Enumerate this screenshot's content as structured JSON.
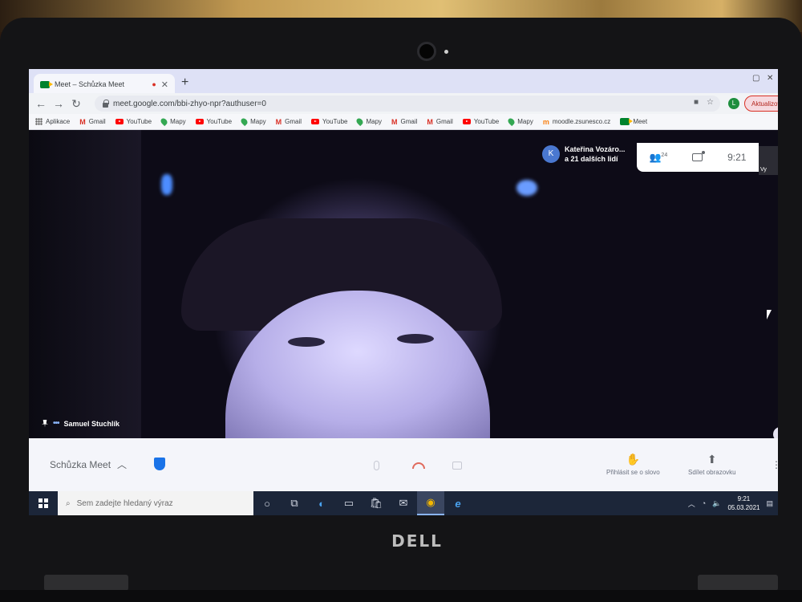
{
  "browser": {
    "tab_title": "Meet – Schůzka Meet",
    "tab_close": "✕",
    "new_tab": "+",
    "url": "meet.google.com/bbi-zhyo-npr?authuser=0",
    "profile_initial": "L",
    "update_label": "Aktualizovat",
    "bookmarks": [
      {
        "label": "Aplikace",
        "icon": "apps-icon"
      },
      {
        "label": "Gmail",
        "icon": "gmail-icon"
      },
      {
        "label": "YouTube",
        "icon": "youtube-icon"
      },
      {
        "label": "Mapy",
        "icon": "maps-icon"
      },
      {
        "label": "YouTube",
        "icon": "youtube-icon"
      },
      {
        "label": "Mapy",
        "icon": "maps-icon"
      },
      {
        "label": "Gmail",
        "icon": "gmail-icon"
      },
      {
        "label": "YouTube",
        "icon": "youtube-icon"
      },
      {
        "label": "Mapy",
        "icon": "maps-icon"
      },
      {
        "label": "Gmail",
        "icon": "gmail-icon"
      },
      {
        "label": "Gmail",
        "icon": "gmail-icon"
      },
      {
        "label": "YouTube",
        "icon": "youtube-icon"
      },
      {
        "label": "Mapy",
        "icon": "maps-icon"
      },
      {
        "label": "moodle.zsunesco.cz",
        "icon": "moodle-icon"
      },
      {
        "label": "Meet",
        "icon": "meet-icon"
      }
    ]
  },
  "meet": {
    "participant_name": "Samuel Stuchlík",
    "presenter_initial": "K",
    "presenter_name": "Kateřina Vozáro...",
    "others_label": "a 21 dalších lidí",
    "people_count": "24",
    "time": "9:21",
    "self_label": "Vy",
    "meeting_title": "Schůzka Meet",
    "raise_hand_label": "Přihlásit se o slovo",
    "present_label": "Sdílet obrazovku"
  },
  "taskbar": {
    "search_placeholder": "Sem zadejte hledaný výraz",
    "clock_time": "9:21",
    "clock_date": "05.03.2021"
  },
  "colors": {
    "meet_green": "#00832d",
    "hangup_red": "#e06a5c",
    "accent_blue": "#1a73e8",
    "taskbar_bg": "#1c2639"
  }
}
